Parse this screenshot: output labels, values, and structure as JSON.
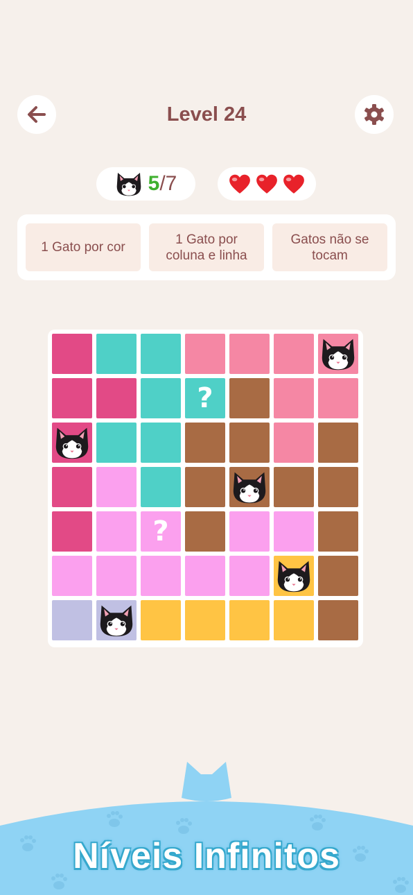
{
  "header": {
    "title": "Level 24",
    "back_icon": "arrow-left-icon",
    "settings_icon": "gear-icon"
  },
  "status": {
    "cats_found": "5",
    "cats_total": "/7",
    "lives": 3,
    "heart_icon": "heart-icon",
    "cat_icon": "cat-face-icon"
  },
  "rules": [
    {
      "line1": "1 Gato por cor",
      "line2": ""
    },
    {
      "line1": "1 Gato por",
      "line2": "coluna e linha"
    },
    {
      "line1": "Gatos não se",
      "line2": "tocam"
    }
  ],
  "board": {
    "size": 7,
    "colors": {
      "M": "#e24a86",
      "T": "#4fd0c7",
      "P": "#f587a4",
      "B": "#a86b44",
      "L": "#fba0ee",
      "V": "#c0c0e3",
      "Y": "#ffc444"
    },
    "rows": [
      [
        "M",
        "T",
        "T",
        "P",
        "P",
        "P",
        "P"
      ],
      [
        "M",
        "M",
        "T",
        "T",
        "B",
        "P",
        "P"
      ],
      [
        "M",
        "T",
        "T",
        "B",
        "B",
        "P",
        "B"
      ],
      [
        "M",
        "L",
        "T",
        "B",
        "B",
        "B",
        "B"
      ],
      [
        "M",
        "L",
        "L",
        "B",
        "L",
        "L",
        "B"
      ],
      [
        "L",
        "L",
        "L",
        "L",
        "L",
        "Y",
        "B"
      ],
      [
        "V",
        "V",
        "Y",
        "Y",
        "Y",
        "Y",
        "B"
      ]
    ],
    "marks": [
      [
        null,
        null,
        null,
        null,
        null,
        null,
        "cat"
      ],
      [
        null,
        null,
        null,
        "?",
        null,
        null,
        null
      ],
      [
        "cat",
        null,
        null,
        null,
        null,
        null,
        null
      ],
      [
        null,
        null,
        null,
        null,
        "cat",
        null,
        null
      ],
      [
        null,
        null,
        "?",
        null,
        null,
        null,
        null
      ],
      [
        null,
        null,
        null,
        null,
        null,
        "cat",
        null
      ],
      [
        null,
        "cat",
        null,
        null,
        null,
        null,
        null
      ]
    ]
  },
  "banner": {
    "text": "Níveis Infinitos",
    "color": "#8fd3f4"
  },
  "colors": {
    "background": "#f6f0eb",
    "title": "#8a4e4e",
    "found_count": "#3fb02f",
    "heart": "#e8222a"
  }
}
